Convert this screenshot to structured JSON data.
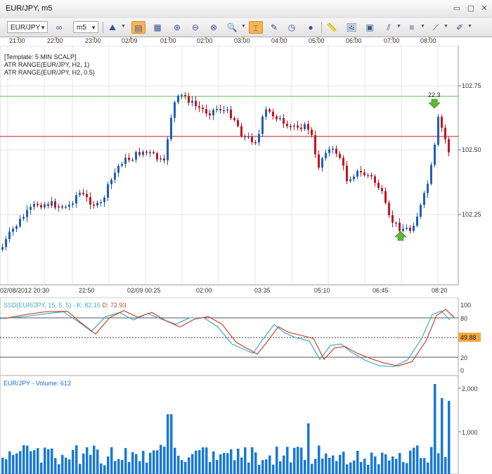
{
  "window": {
    "title": "EUR/JPY, m5"
  },
  "toolbar": {
    "symbol": "EUR/JPY",
    "timeframe": "m5"
  },
  "top_time_axis": [
    "21:00",
    "22:00",
    "23:00",
    "02/09",
    "01:00",
    "02:00",
    "03:00",
    "04:00",
    "05:00",
    "06:00",
    "07:00",
    "08:00"
  ],
  "main_chart": {
    "legend": [
      "[Template: 5 MIN SCALP]",
      "ATR RANGE(EUR/JPY, H2, 1)",
      "ATR RANGE(EUR/JPY, H2, 0.5)"
    ],
    "price_labels": [
      "102.75",
      "102.50",
      "102.25"
    ],
    "marker_label": "22.3",
    "bottom_time_axis": [
      "02/08/2012 20:30",
      "22:50",
      "02/09 00:25",
      "02:00",
      "03:35",
      "05:10",
      "06:45",
      "08:20"
    ],
    "colors": {
      "up": "#1f5fb4",
      "down": "#c0151e",
      "upper_line": "#55c04a",
      "lower_line": "#b81c24",
      "arrow": "#5fb830"
    }
  },
  "oscillator": {
    "legend_prefix": "SSD(EUR/JPY, 15, 5, 5) -",
    "k_label": "K: 82.15",
    "d_label": "D: 72.93",
    "levels": [
      "100",
      "80",
      "20",
      "0"
    ],
    "current_value": "49.88",
    "colors": {
      "k": "#3aaad0",
      "d": "#c8452a"
    }
  },
  "volume": {
    "legend": "EUR/JPY - Volume: 613",
    "labels": [
      "2,000",
      "1,000"
    ]
  }
}
